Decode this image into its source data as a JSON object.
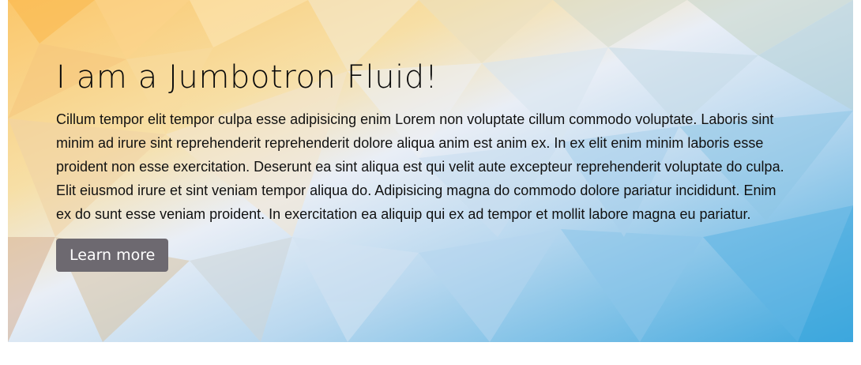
{
  "jumbotron": {
    "title": "I am a Jumbotron Fluid!",
    "lead": "Cillum tempor elit tempor culpa esse adipisicing enim Lorem non voluptate cillum commodo voluptate. Laboris sint minim ad irure sint reprehenderit reprehenderit dolore aliqua anim est anim ex. In ex elit enim minim laboris esse proident non esse exercitation. Deserunt ea sint aliqua est qui velit aute excepteur reprehenderit voluptate do culpa. Elit eiusmod irure et sint veniam tempor aliqua do. Adipisicing magna do commodo dolore pariatur incididunt. Enim ex do sunt esse veniam proident. In exercitation ea aliquip qui ex ad tempor et mollit labore magna eu pariatur.",
    "button_label": "Learn more"
  },
  "colors": {
    "warm": "#f9d17f",
    "cool": "#5cb0e3",
    "button": "#6d6970"
  }
}
